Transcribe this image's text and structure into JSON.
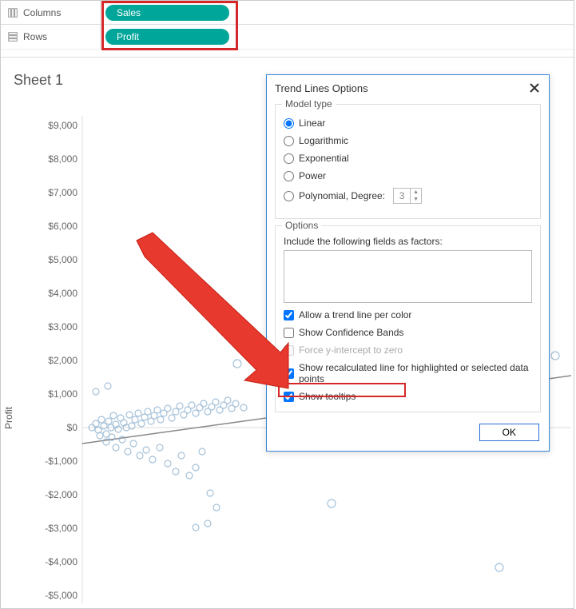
{
  "shelves": {
    "columns_label": "Columns",
    "rows_label": "Rows",
    "columns_pill": "Sales",
    "rows_pill": "Profit"
  },
  "sheet": {
    "title": "Sheet 1",
    "y_axis_label": "Profit"
  },
  "chart_data": {
    "type": "scatter",
    "xlabel": "",
    "ylabel": "Profit",
    "ylim": [
      -5000,
      9000
    ],
    "y_ticks": [
      "$9,000",
      "$8,000",
      "$7,000",
      "$6,000",
      "$5,000",
      "$4,000",
      "$3,000",
      "$2,000",
      "$1,000",
      "$0",
      "-$1,000",
      "-$2,000",
      "-$3,000",
      "-$4,000",
      "-$5,000"
    ],
    "title": "Sheet 1",
    "trend_line": {
      "approx_intercept_value": 0,
      "slope_sign": "positive"
    },
    "note": "Dense cluster of light-blue circles near y=0 extending right; some outliers below 0 and above 0."
  },
  "dialog": {
    "title": "Trend Lines Options",
    "model_section": "Model type",
    "models": {
      "linear": "Linear",
      "logarithmic": "Logarithmic",
      "exponential": "Exponential",
      "power": "Power",
      "polynomial": "Polynomial, Degree:",
      "degree_value": "3"
    },
    "options_section": "Options",
    "include_fields_label": "Include the following fields as factors:",
    "allow_trend_per_color": "Allow a trend line per color",
    "show_confidence": "Show Confidence Bands",
    "force_y_intercept": "Force y-intercept to zero",
    "show_recalc": "Show recalculated line for highlighted or selected data points",
    "show_tooltips": "Show tooltips",
    "ok": "OK"
  }
}
